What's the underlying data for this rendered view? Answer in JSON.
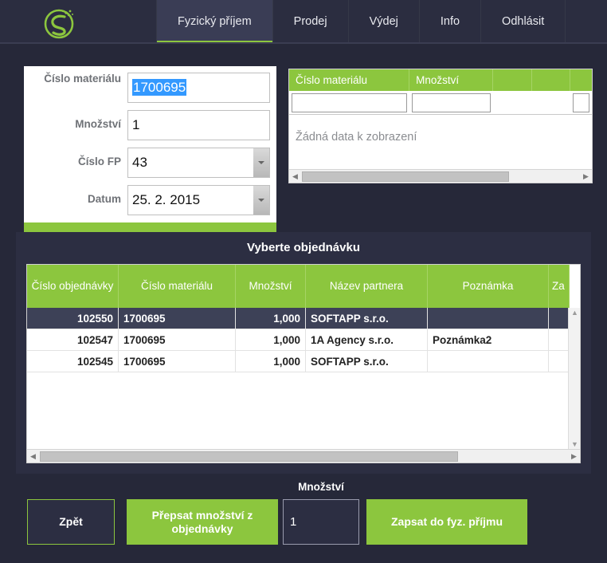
{
  "theme": {
    "green": "#8CC63E",
    "dark_bg": "#262839",
    "panel_bg": "#2C2E42",
    "nav_bg": "#2B2D40",
    "active_tab_bg": "#3A3D55",
    "selection_blue": "#3399FF",
    "selected_row_bg": "#3D4157"
  },
  "nav": {
    "logo_name": "softapp-leaf-logo",
    "items": [
      {
        "label": "Fyzický příjem",
        "active": true
      },
      {
        "label": "Prodej",
        "active": false
      },
      {
        "label": "Výdej",
        "active": false
      },
      {
        "label": "Info",
        "active": false
      },
      {
        "label": "Odhlásit",
        "active": false
      }
    ]
  },
  "form": {
    "fields": [
      {
        "label": "Číslo materiálu",
        "value": "1700695",
        "type": "text",
        "selected": true
      },
      {
        "label": "Množství",
        "value": "1",
        "type": "text",
        "selected": false
      },
      {
        "label": "Číslo FP",
        "value": "43",
        "type": "combo",
        "selected": false
      },
      {
        "label": "Datum",
        "value": "25. 2. 2015",
        "type": "combo",
        "selected": false
      }
    ]
  },
  "receipt_grid": {
    "columns": [
      "Číslo materiálu",
      "Množství",
      "",
      "",
      ""
    ],
    "filters": [
      "",
      "",
      null,
      null,
      ""
    ],
    "empty_message": "Žádná data k zobrazení",
    "rows": []
  },
  "order_panel": {
    "title": "Vyberte objednávku",
    "columns": [
      "Číslo objednávky",
      "Číslo materiálu",
      "Množství",
      "Název partnera",
      "Poznámka",
      "Za"
    ],
    "rows": [
      {
        "selected": true,
        "cells": [
          "102550",
          "1700695",
          "1,000",
          "SOFTAPP s.r.o.",
          "",
          ""
        ]
      },
      {
        "selected": false,
        "cells": [
          "102547",
          "1700695",
          "1,000",
          "1A Agency s.r.o.",
          "Poznámka2",
          ""
        ]
      },
      {
        "selected": false,
        "cells": [
          "102545",
          "1700695",
          "1,000",
          "SOFTAPP s.r.o.",
          "",
          ""
        ]
      }
    ]
  },
  "actions": {
    "quantity_caption": "Množství",
    "back_label": "Zpět",
    "overwrite_label": "Přepsat množství z objednávky",
    "quantity_value": "1",
    "write_label": "Zapsat do fyz. příjmu"
  }
}
